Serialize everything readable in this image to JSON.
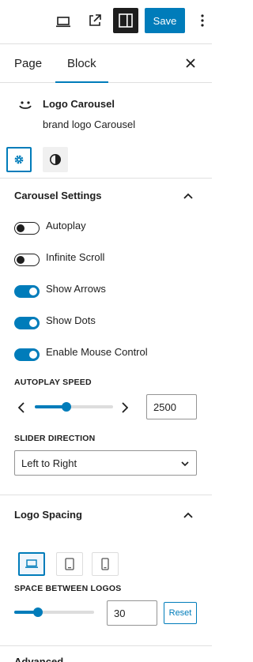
{
  "toolbar": {
    "laptop_icon": "laptop-icon",
    "external_icon": "external-link-icon",
    "sidebar_icon": "sidebar-toggle-icon",
    "save_label": "Save",
    "more_icon": "more-vertical-icon"
  },
  "tabs": {
    "page_label": "Page",
    "block_label": "Block",
    "active": "Block",
    "close_icon": "close-icon"
  },
  "block": {
    "icon": "smiley-icon",
    "name": "Logo Carousel",
    "description": "brand logo Carousel",
    "settings_tab_icon": "gear-icon",
    "styles_tab_icon": "half-circle-icon"
  },
  "carousel_settings": {
    "title": "Carousel Settings",
    "expanded": true,
    "toggles": [
      {
        "label": "Autoplay",
        "on": false
      },
      {
        "label": "Infinite Scroll",
        "on": false
      },
      {
        "label": "Show Arrows",
        "on": true
      },
      {
        "label": "Show Dots",
        "on": true
      },
      {
        "label": "Enable Mouse Control",
        "on": true
      }
    ],
    "autoplay_speed_label": "AUTOPLAY SPEED",
    "autoplay_speed_value": "2500",
    "autoplay_speed_fraction": 0.4,
    "slider_direction_label": "SLIDER DIRECTION",
    "slider_direction_value": "Left to Right"
  },
  "logo_spacing": {
    "title": "Logo Spacing",
    "expanded": true,
    "devices": [
      "desktop",
      "tablet",
      "mobile"
    ],
    "active_device": "desktop",
    "space_label": "SPACE BETWEEN LOGOS",
    "space_value": "30",
    "space_fraction": 0.3,
    "reset_label": "Reset"
  },
  "advanced": {
    "title": "Advanced"
  },
  "colors": {
    "accent": "#007cba",
    "dark": "#1e1e1e",
    "border": "#e0e0e0"
  }
}
